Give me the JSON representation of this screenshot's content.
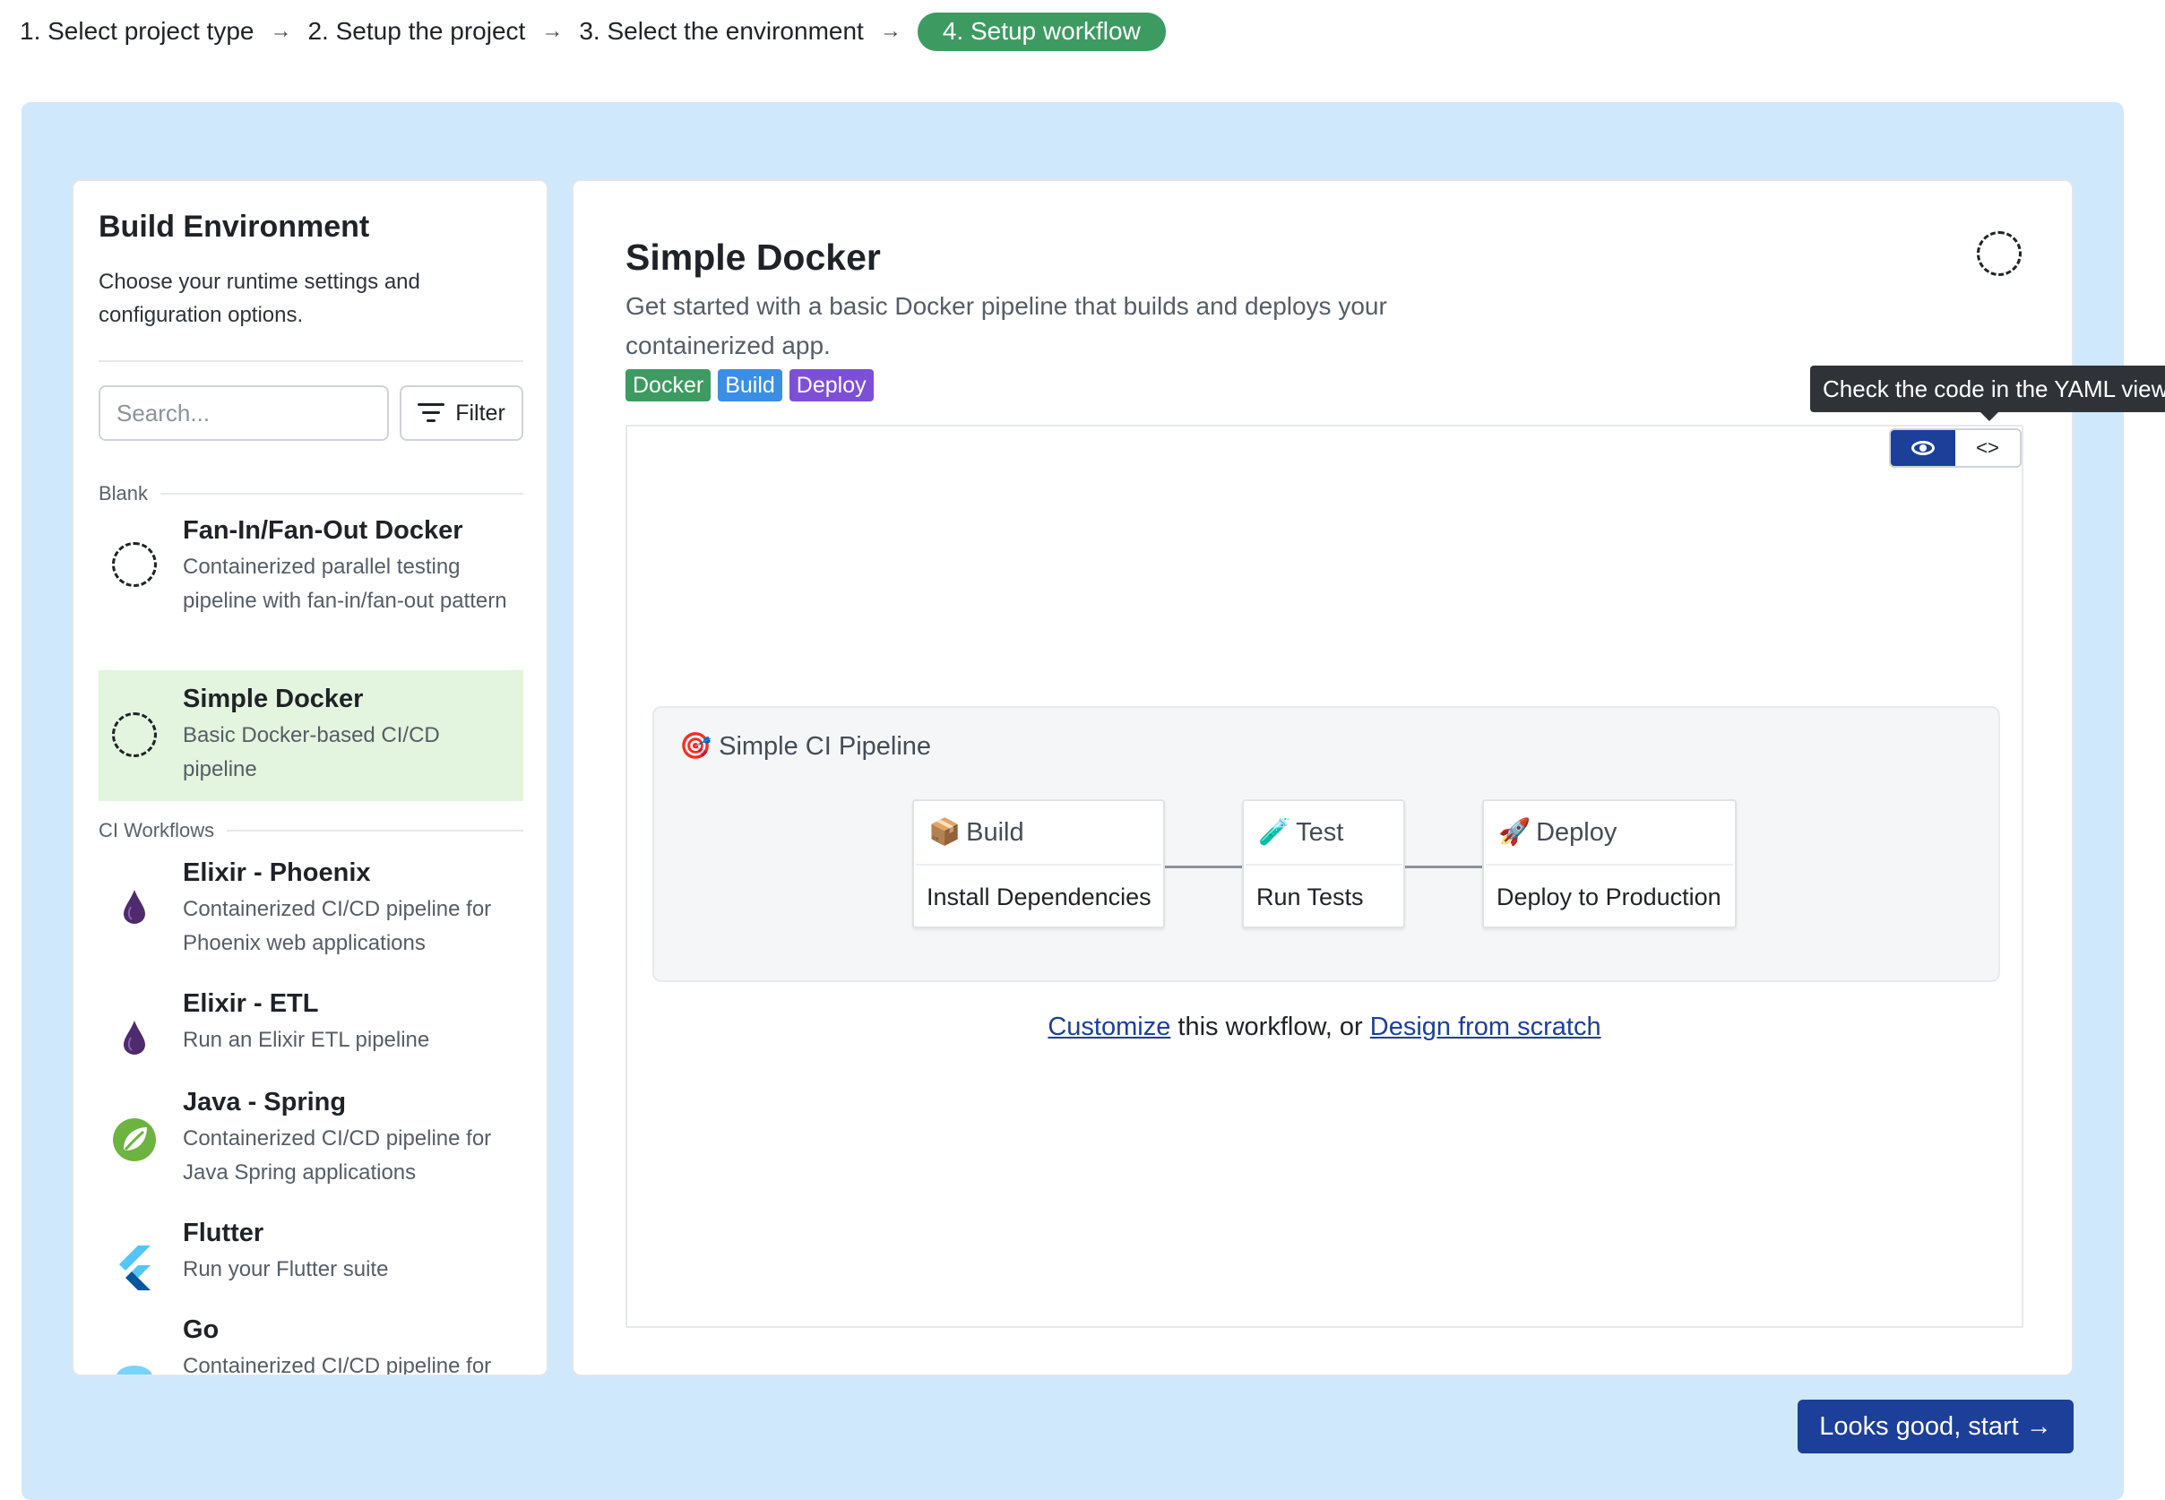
{
  "stepper": {
    "steps": [
      "1. Select project type",
      "2. Setup the project",
      "3. Select the environment",
      "4. Setup workflow"
    ],
    "arrow": "→"
  },
  "sidebar": {
    "title": "Build Environment",
    "description": "Choose your runtime settings and configuration options.",
    "search_placeholder": "Search...",
    "filter_label": "Filter",
    "groups": [
      "Blank",
      "CI Workflows"
    ],
    "items": [
      {
        "name": "Fan-In/Fan-Out Docker",
        "desc": "Containerized parallel testing pipeline with fan-in/fan-out pattern",
        "icon": "dashed-circle-icon"
      },
      {
        "name": "Simple Docker",
        "desc": "Basic Docker-based CI/CD pipeline",
        "icon": "dashed-circle-icon",
        "selected": true
      },
      {
        "name": "Elixir - Phoenix",
        "desc": "Containerized CI/CD pipeline for Phoenix web applications",
        "icon": "elixir-drop-icon"
      },
      {
        "name": "Elixir - ETL",
        "desc": "Run an Elixir ETL pipeline",
        "icon": "elixir-drop-icon"
      },
      {
        "name": "Java - Spring",
        "desc": "Containerized CI/CD pipeline for Java Spring applications",
        "icon": "spring-leaf-icon"
      },
      {
        "name": "Flutter",
        "desc": "Run your Flutter suite",
        "icon": "flutter-icon"
      },
      {
        "name": "Go",
        "desc": "Containerized CI/CD pipeline for",
        "icon": "go-icon"
      }
    ]
  },
  "main": {
    "title": "Simple Docker",
    "description": "Get started with a basic Docker pipeline that builds and deploys your containerized app.",
    "tags": [
      {
        "label": "Docker",
        "color": "#3d9b62"
      },
      {
        "label": "Build",
        "color": "#3b8ee6"
      },
      {
        "label": "Deploy",
        "color": "#7d4fd6"
      }
    ],
    "view_toggle": {
      "visual_icon": "eye-icon",
      "code_label": "<>",
      "active": "visual"
    },
    "tooltip": "Check the code in the YAML view",
    "pipeline": {
      "title_emoji": "🎯",
      "title": "Simple CI Pipeline",
      "stages": [
        {
          "emoji": "📦",
          "name": "Build",
          "job": "Install Dependencies"
        },
        {
          "emoji": "🧪",
          "name": "Test",
          "job": "Run Tests"
        },
        {
          "emoji": "🚀",
          "name": "Deploy",
          "job": "Deploy to Production"
        }
      ]
    },
    "customize": {
      "link1": "Customize",
      "middle": " this workflow, or ",
      "link2": "Design from scratch"
    }
  },
  "start_button": "Looks good, start →",
  "colors": {
    "accent": "#1c3f99",
    "active_step": "#3d9b62",
    "canvas": "#cfe8fb",
    "selected_item": "#e3f4df"
  }
}
